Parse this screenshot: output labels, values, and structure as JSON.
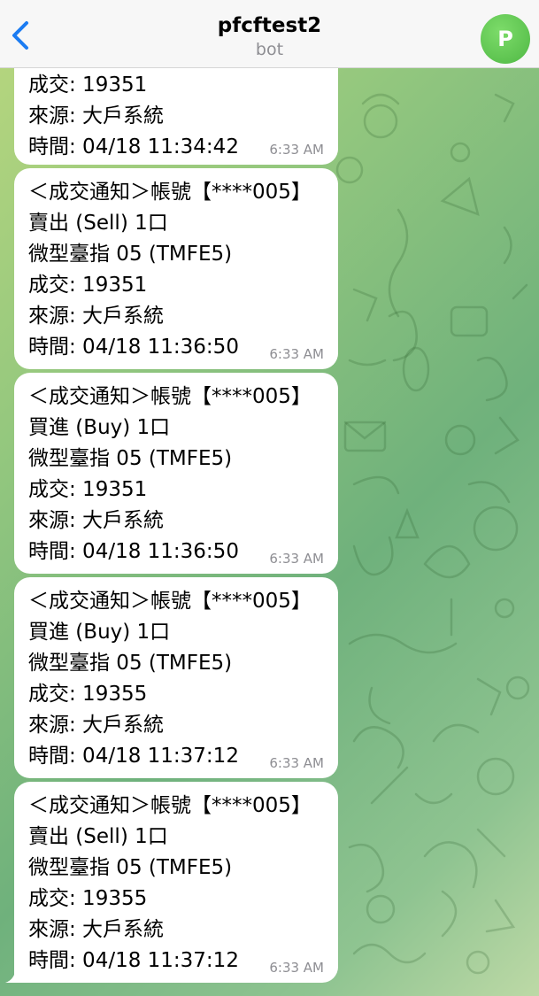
{
  "header": {
    "title": "pfcftest2",
    "subtitle": "bot",
    "avatar_letter": "P"
  },
  "messages": [
    {
      "lines": [
        "成交: 19351",
        "來源: 大戶系統",
        "時間: 04/18 11:34:42"
      ],
      "time": "6:33 AM"
    },
    {
      "lines": [
        "＜成交通知＞帳號【****005】",
        "賣出 (Sell)   1口",
        "微型臺指 05 (TMFE5)",
        "成交: 19351",
        "來源: 大戶系統",
        "時間: 04/18 11:36:50"
      ],
      "time": "6:33 AM"
    },
    {
      "lines": [
        "＜成交通知＞帳號【****005】",
        "買進 (Buy)   1口",
        "微型臺指 05 (TMFE5)",
        "成交: 19351",
        "來源: 大戶系統",
        "時間: 04/18 11:36:50"
      ],
      "time": "6:33 AM"
    },
    {
      "lines": [
        "＜成交通知＞帳號【****005】",
        "買進 (Buy)   1口",
        "微型臺指 05 (TMFE5)",
        "成交: 19355",
        "來源: 大戶系統",
        "時間: 04/18 11:37:12"
      ],
      "time": "6:33 AM"
    },
    {
      "lines": [
        "＜成交通知＞帳號【****005】",
        "賣出 (Sell)   1口",
        "微型臺指 05 (TMFE5)",
        "成交: 19355",
        "來源: 大戶系統",
        "時間: 04/18 11:37:12"
      ],
      "time": "6:33 AM"
    }
  ],
  "icons": {
    "back": "chevron-left-icon",
    "avatar": "avatar"
  },
  "colors": {
    "accent": "#1b7cf2",
    "avatar": "#5cc24c",
    "bubble": "#ffffff",
    "time": "#8e8e93"
  }
}
